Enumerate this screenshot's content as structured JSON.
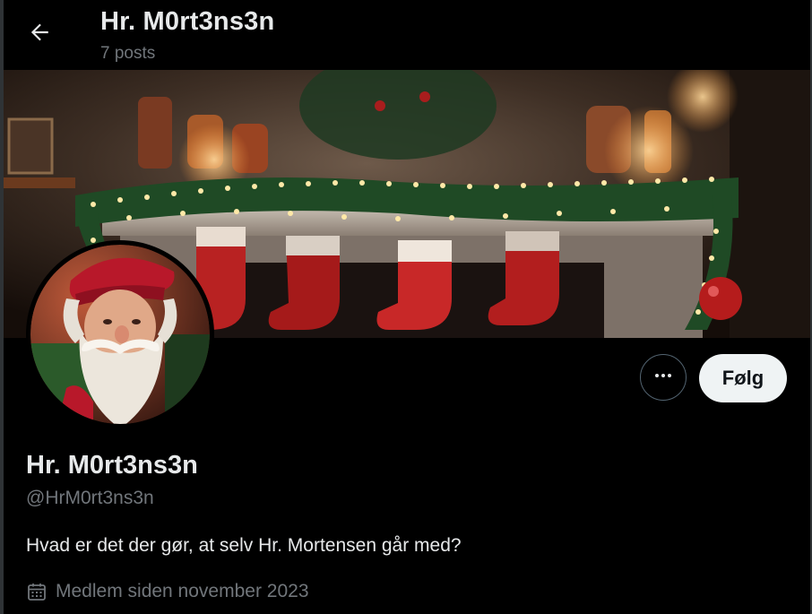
{
  "header": {
    "title": "Hr. M0rt3ns3n",
    "post_count": "7 posts",
    "back_icon": "arrow-left-icon"
  },
  "profile": {
    "display_name": "Hr. M0rt3ns3n",
    "handle": "@HrM0rt3ns3n",
    "bio": "Hvad er det der gør, at selv Hr. Mortensen går med?",
    "joined": "Medlem siden november 2023",
    "joined_icon": "calendar-icon"
  },
  "actions": {
    "more_icon": "more-options-icon",
    "follow_label": "Følg"
  },
  "colors": {
    "background": "#000000",
    "text_primary": "#e7e9ea",
    "text_secondary": "#71767b",
    "follow_bg": "#eff3f4",
    "border": "#536471"
  }
}
